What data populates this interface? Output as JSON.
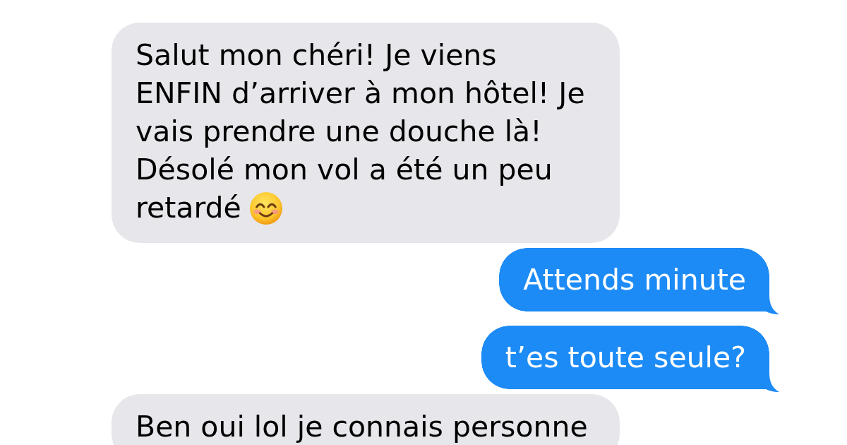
{
  "messages": [
    {
      "kind": "received",
      "text": "Salut mon chéri! Je viens ENFIN d’arriver à mon hôtel! Je vais prendre une douche là! Désolé mon vol a été un peu retardé",
      "emoji": true
    },
    {
      "kind": "sent",
      "text": "Attends minute"
    },
    {
      "kind": "sent",
      "text": "t’es toute seule?"
    },
    {
      "kind": "received",
      "text": "Ben oui lol je connais personne"
    }
  ]
}
